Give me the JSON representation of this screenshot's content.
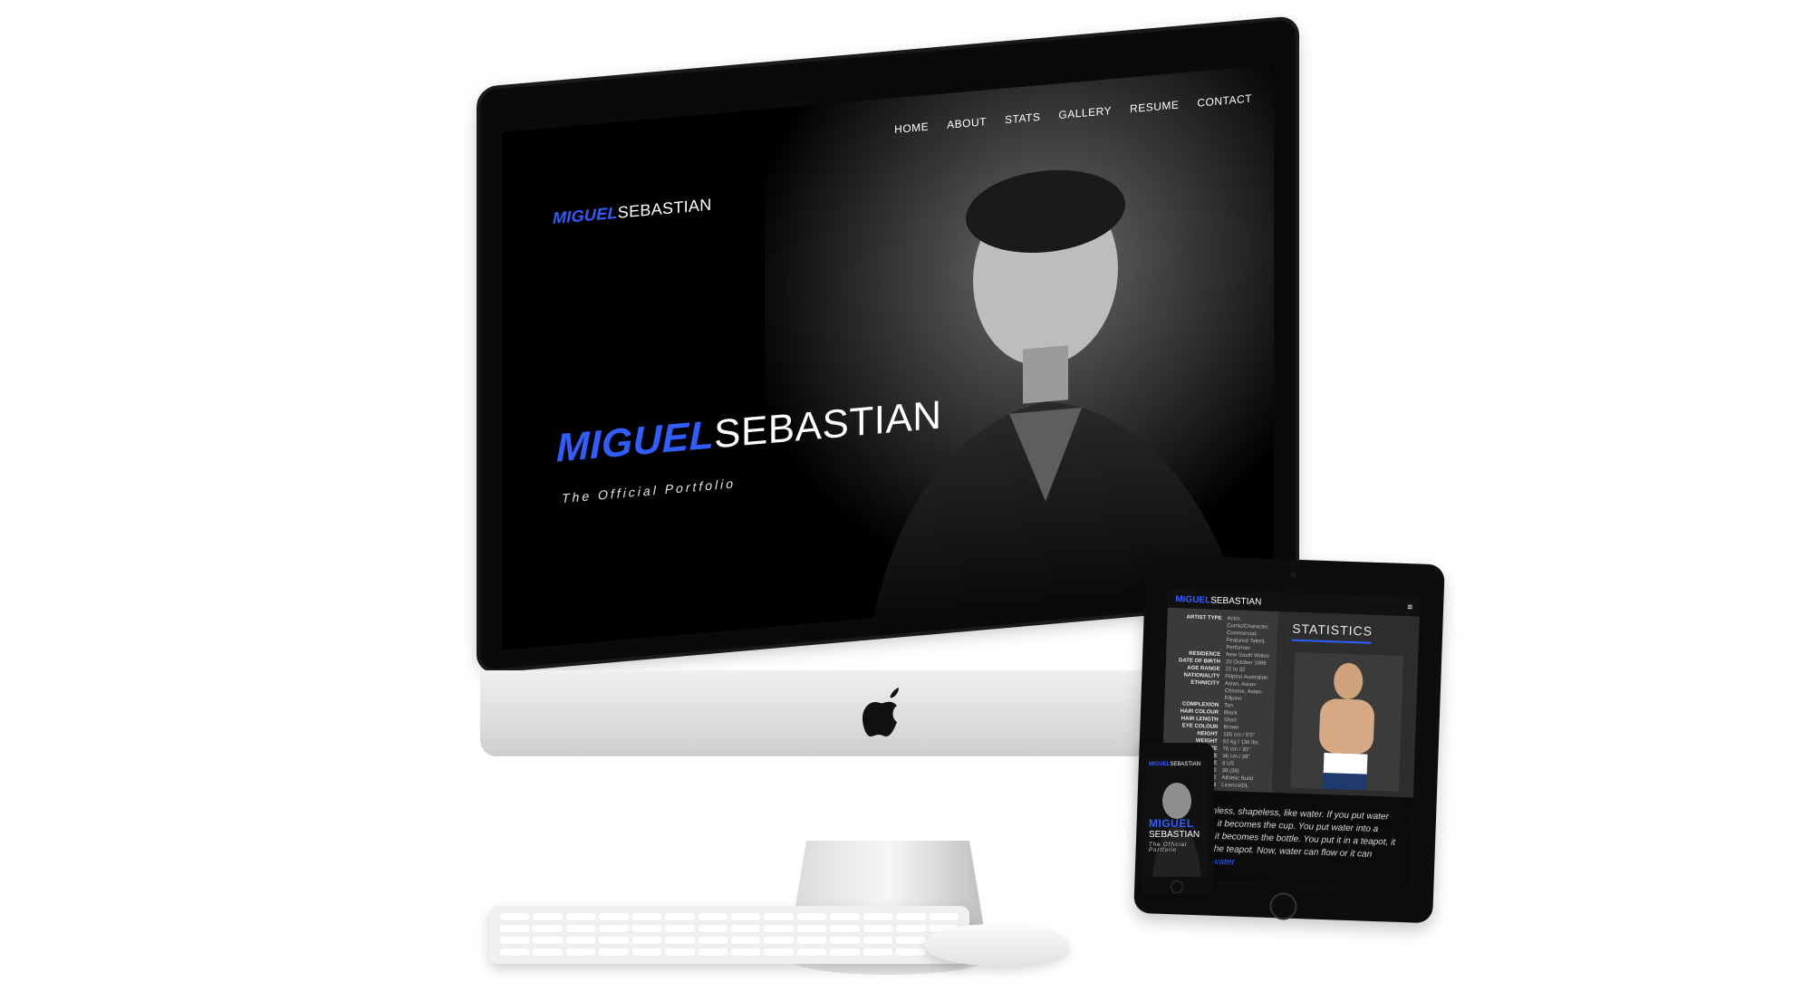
{
  "imac": {
    "logo_small": {
      "first": "MIGUEL",
      "last": "SEBASTIAN"
    },
    "nav": [
      "HOME",
      "ABOUT",
      "STATS",
      "GALLERY",
      "RESUME",
      "CONTACT"
    ],
    "hero": {
      "first": "MIGUEL",
      "last": "SEBASTIAN",
      "tagline": "The Official Portfolio"
    },
    "brand_icon": "apple-logo"
  },
  "ipad": {
    "logo": {
      "first": "MIGUEL",
      "last": "SEBASTIAN"
    },
    "menu_icon": "hamburger-icon",
    "stats_title": "STATISTICS",
    "stats": [
      {
        "k": "ARTIST TYPE",
        "v": "Actor, Comic/Character, Commercial, Featured Talent, Performer"
      },
      {
        "k": "RESIDENCE",
        "v": "New South Wales"
      },
      {
        "k": "DATE OF BIRTH",
        "v": "20 October 1986"
      },
      {
        "k": "AGE RANGE",
        "v": "22 to 32"
      },
      {
        "k": "NATIONALITY",
        "v": "Filipino Australian"
      },
      {
        "k": "ETHNICITY",
        "v": "Asian, Asian-Chinese, Asian-Filipino"
      },
      {
        "k": "COMPLEXION",
        "v": "Tan"
      },
      {
        "k": "HAIR COLOUR",
        "v": "Black"
      },
      {
        "k": "HAIR LENGTH",
        "v": "Short"
      },
      {
        "k": "EYE COLOUR",
        "v": "Brown"
      },
      {
        "k": "HEIGHT",
        "v": "165 cm / 5'5\""
      },
      {
        "k": "WEIGHT",
        "v": "62 kg / 136 lbs"
      },
      {
        "k": "WAIST SIZE",
        "v": "76 cm / 30\""
      },
      {
        "k": "CHEST SIZE",
        "v": "96 cm / 38\""
      },
      {
        "k": "SHOE SIZE",
        "v": "8 US"
      },
      {
        "k": "SUIT SIZE",
        "v": "38 (36)"
      },
      {
        "k": "BODY TYPE",
        "v": "Athletic Build"
      },
      {
        "k": "LICENCES",
        "v": "Licence/DL"
      }
    ],
    "quote": {
      "text": "Be formless, shapeless, like water. If you put water into a cup, it becomes the cup. You put water into a bottle and it becomes the bottle. You put it in a teapot, it becomes the teapot. Now, water can flow or it can crash.",
      "emphasis": "Be water"
    }
  },
  "iphone": {
    "logo": {
      "first": "MIGUEL",
      "last": "SEBASTIAN"
    },
    "hero": {
      "first": "MIGUEL",
      "last": "SEBASTIAN",
      "tagline": "The Official Portfolio"
    }
  },
  "colors": {
    "accent_blue": "#2f5dff",
    "screen_black": "#000000",
    "panel_gray": "#3a3a3a"
  },
  "icons": {
    "keyboard": "keyboard-icon",
    "mouse": "mouse-icon"
  }
}
